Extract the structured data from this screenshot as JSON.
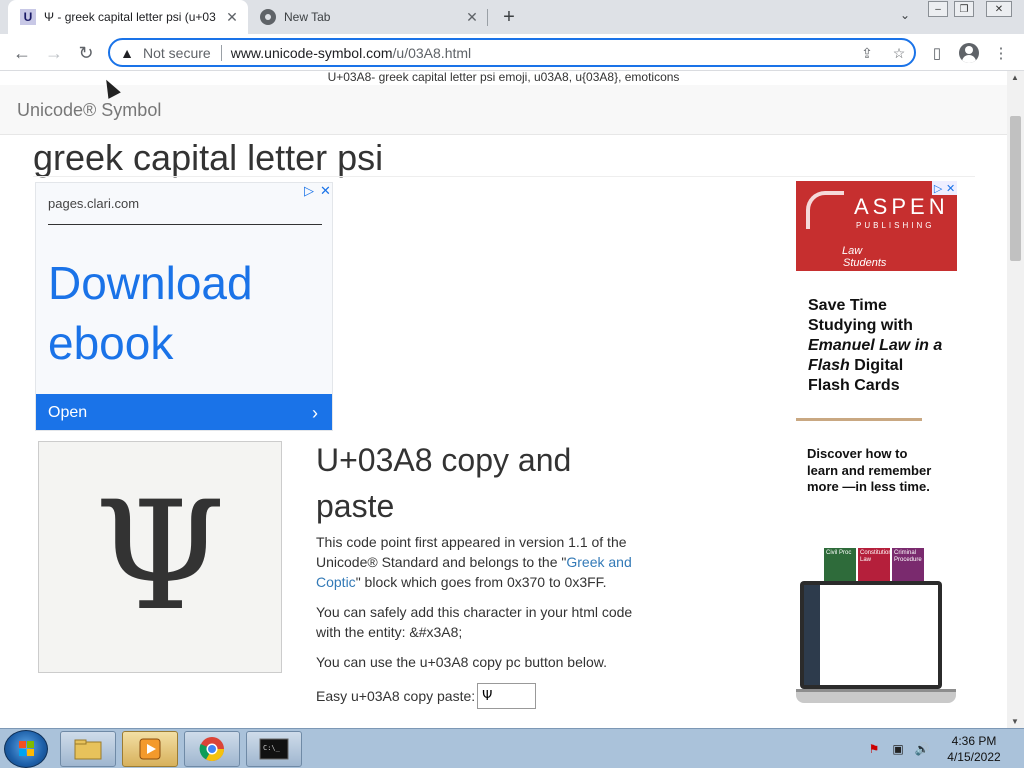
{
  "browser": {
    "tabs": [
      {
        "favicon_letter": "U",
        "title": "Ψ - greek capital letter psi (u+03",
        "close": "✕"
      },
      {
        "title": "New Tab",
        "close": "✕"
      }
    ],
    "new_tab_symbol": "+",
    "tab_search_symbol": "⌄",
    "window_controls": [
      "–",
      "❐",
      "✕"
    ],
    "nav": {
      "back": "←",
      "forward": "→",
      "reload": "↻"
    },
    "omnibox": {
      "security_label": "Not secure",
      "url_domain": "www.unicode-symbol.com",
      "url_path": "/u/03A8.html"
    },
    "toolbar_icons": {
      "share": "⇪",
      "bookmark": "☆",
      "sidepanel": "▯",
      "menu": "⋮"
    }
  },
  "page": {
    "doc_title": "U+03A8- greek capital letter psi emoji, u03A8, u{03A8}, emoticons",
    "brand": "Unicode® Symbol",
    "heading": "greek capital letter psi",
    "glyph": "Ψ",
    "section_title": "U+03A8 copy and paste",
    "para1_a": "This code point first appeared in version 1.1 of the Unicode® Standard and belongs to the \"",
    "para1_link": "Greek and Coptic",
    "para1_b": "\" block which goes from 0x370 to 0x3FF.",
    "para2": "You can safely add this character in your html code with the entity: &#x3A8;",
    "para3": "You can use the u+03A8 copy pc button below.",
    "copy_label": "Easy u+03A8 copy paste:",
    "copy_value": "Ψ"
  },
  "ad_left": {
    "domain": "pages.clari.com",
    "headline_1": "Download",
    "headline_2": "ebook",
    "cta": "Open",
    "cta_arrow": "›",
    "adchoice_play": "▷",
    "adchoice_close": "✕"
  },
  "ad_right": {
    "brand": "ASPEN",
    "brand_sub": "PUBLISHING",
    "tag_1": "Law",
    "tag_2": "Students",
    "headline_a": "Save Time Studying with ",
    "headline_em": "Emanuel Law in a Flash",
    "headline_b": " Digital Flash Cards",
    "body": "Discover how to learn and remember more —in less time.",
    "book_titles": [
      "Civil Proc",
      "Constitutional Law",
      "Criminal Procedure"
    ],
    "adchoice_play": "▷",
    "adchoice_close": "✕"
  },
  "taskbar": {
    "clock_time": "4:36 PM",
    "clock_date": "4/15/2022",
    "tray": [
      "⚑",
      "▣",
      "🔊"
    ]
  },
  "colors": {
    "link": "#337ab7",
    "ad_blue": "#1a73e8",
    "aspen_red": "#c62f2f",
    "omnibox_focus": "#1a73e8"
  }
}
